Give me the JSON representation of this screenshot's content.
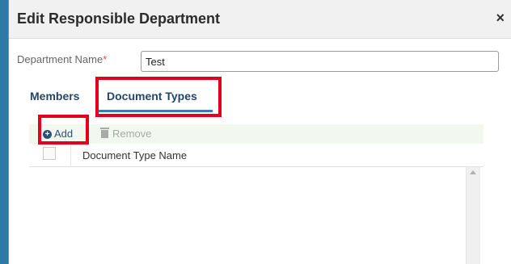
{
  "dialog": {
    "title": "Edit Responsible Department",
    "close_glyph": "×"
  },
  "form": {
    "department_label": "Department Name",
    "required_marker": "*",
    "department_value": "Test"
  },
  "tabs": [
    {
      "label": "Members",
      "active": false
    },
    {
      "label": "Document Types",
      "active": true
    }
  ],
  "toolbar": {
    "add_label": "Add",
    "remove_label": "Remove"
  },
  "grid": {
    "columns": [
      "Document Type Name"
    ],
    "rows": []
  },
  "colors": {
    "highlight": "#e4001b",
    "tab_text": "#25456b",
    "active_tab_underline": "#3f79b5",
    "toolbar_bg": "#f2f8ef"
  },
  "icons": {
    "add": "plus-circle-icon",
    "remove": "trash-icon",
    "close": "close-icon"
  }
}
